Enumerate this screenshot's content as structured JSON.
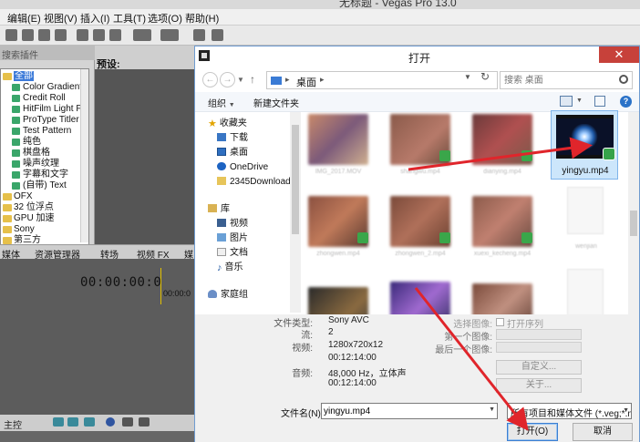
{
  "app": {
    "title": "无标题 - Vegas Pro 13.0",
    "menu": [
      "编辑(E)",
      "视图(V)",
      "插入(I)",
      "工具(T)",
      "选项(O)",
      "帮助(H)"
    ]
  },
  "fx_panel": {
    "header": "搜索插件",
    "items": [
      {
        "label": "全部",
        "kind": "folder",
        "selected": true
      },
      {
        "label": "Color Gradient",
        "kind": "sub"
      },
      {
        "label": "Credit Roll",
        "kind": "sub"
      },
      {
        "label": "HitFilm Light Fla",
        "kind": "sub"
      },
      {
        "label": "ProType Titler",
        "kind": "sub"
      },
      {
        "label": "Test Pattern",
        "kind": "sub"
      },
      {
        "label": "纯色",
        "kind": "sub"
      },
      {
        "label": "棋盘格",
        "kind": "sub"
      },
      {
        "label": "噪声纹理",
        "kind": "sub"
      },
      {
        "label": "字幕和文字",
        "kind": "sub"
      },
      {
        "label": "(自带) Text",
        "kind": "sub"
      },
      {
        "label": "OFX",
        "kind": "folder"
      },
      {
        "label": "32 位浮点",
        "kind": "folder"
      },
      {
        "label": "GPU 加速",
        "kind": "folder"
      },
      {
        "label": "Sony",
        "kind": "folder"
      },
      {
        "label": "第三方",
        "kind": "folder"
      }
    ]
  },
  "preview": {
    "label": "预设:"
  },
  "bottom_tabs": [
    "媒体",
    "资源管理器",
    "转场",
    "视频 FX",
    "媒"
  ],
  "timeline": {
    "timecode": "00:00:00:00",
    "ruler_time": "00:00:0",
    "master_label": "主控"
  },
  "dialog": {
    "title": "打开",
    "close_label": "✕",
    "address": {
      "crumb": "桌面",
      "search_placeholder": "搜索 桌面"
    },
    "commands": {
      "organize": "组织",
      "new_folder": "新建文件夹",
      "help": "?"
    },
    "nav": {
      "favorites": "收藏夹",
      "downloads": "下载",
      "desktop": "桌面",
      "onedrive": "OneDrive",
      "downloads2345": "2345Downloads",
      "libraries": "库",
      "videos": "视频",
      "pictures": "图片",
      "documents": "文档",
      "music": "音乐",
      "homegroup": "家庭组"
    },
    "files": {
      "selected_name": "yingyu.mp4",
      "blurred_labels": [
        "IMG_2017.MOV",
        "shangwu.mp4",
        "dianying.mp4",
        "zhongwen.mp4",
        "zhongwen_2.mp4",
        "xuexi_kecheng.mp4",
        "wenjian"
      ]
    },
    "details": {
      "file_type_label": "文件类型:",
      "file_type_value": "Sony AVC",
      "streams_label": "流:",
      "streams_value": "2",
      "video_label": "视频:",
      "video_value": "1280x720x12",
      "video_duration": "00:12:14:00",
      "audio_label": "音频:",
      "audio_value": "48,000 Hz，立体声",
      "audio_duration": "00:12:14:00",
      "sequence_label": "选择图像:",
      "open_sequence": "打开序列",
      "first_image_label": "第一个图像:",
      "last_image_label": "最后一个图像:",
      "custom_button": "自定义...",
      "about_button": "关于..."
    },
    "filename_label": "文件名(N):",
    "filename_value": "yingyu.mp4",
    "filetype_select": "所有项目和媒体文件 (*.veg;*.m",
    "open_button": "打开(O)",
    "cancel_button": "取消"
  },
  "colors": {
    "annotation_arrow": "#e0252b",
    "selection_bg": "#cce6fb",
    "dialog_border": "#6e9bd0"
  }
}
